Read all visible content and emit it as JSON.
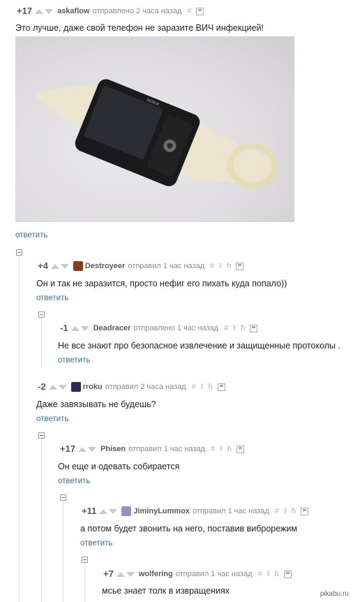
{
  "post": {
    "rating": "+17",
    "author": "askaflow",
    "time": "отправлено 2 часа назад",
    "text": "Это лучше, даже свой телефон не заразите ВИЧ инфекцией!",
    "reply": "ответить"
  },
  "comments": [
    {
      "rating": "+4",
      "author": "Destroyeer",
      "time": "отправил 1 час назад",
      "text": "Он и так не заразится, просто нефиг его пихать куда попало))",
      "reply": "ответить",
      "avatar_color": "#8b3a1e"
    },
    {
      "rating": "-1",
      "author": "Deadracer",
      "time": "отправлено 1 час назад",
      "text": "Не все знают про безопасное извлечение и защищенные протоколы .",
      "reply": "ответить"
    },
    {
      "rating": "-2",
      "author": "rroku",
      "time": "отправил 2 часа назад",
      "text": "Даже завязывать не будешь?",
      "reply": "ответить",
      "avatar_color": "#2b2b55"
    },
    {
      "rating": "+17",
      "author": "Phisen",
      "time": "отправил 1 час назад",
      "text": "Он еще и одевать собирается",
      "reply": "ответить"
    },
    {
      "rating": "+11",
      "author": "JiminyLummox",
      "time": "отправил 1 час назад",
      "text": "а потом будет звонить на него, поставив виброрежим",
      "reply": "ответить",
      "avatar_color": "#9a8fc0"
    },
    {
      "rating": "+7",
      "author": "wolfering",
      "time": "отправил 1 час назад",
      "text": "мсье знает толк в извращениях",
      "reply": ""
    }
  ],
  "tools": {
    "hash": "#",
    "up": "⭱",
    "parent": "ɦ"
  },
  "photo": {
    "brand": "NOKIA"
  },
  "watermark": "pikabu.ru"
}
